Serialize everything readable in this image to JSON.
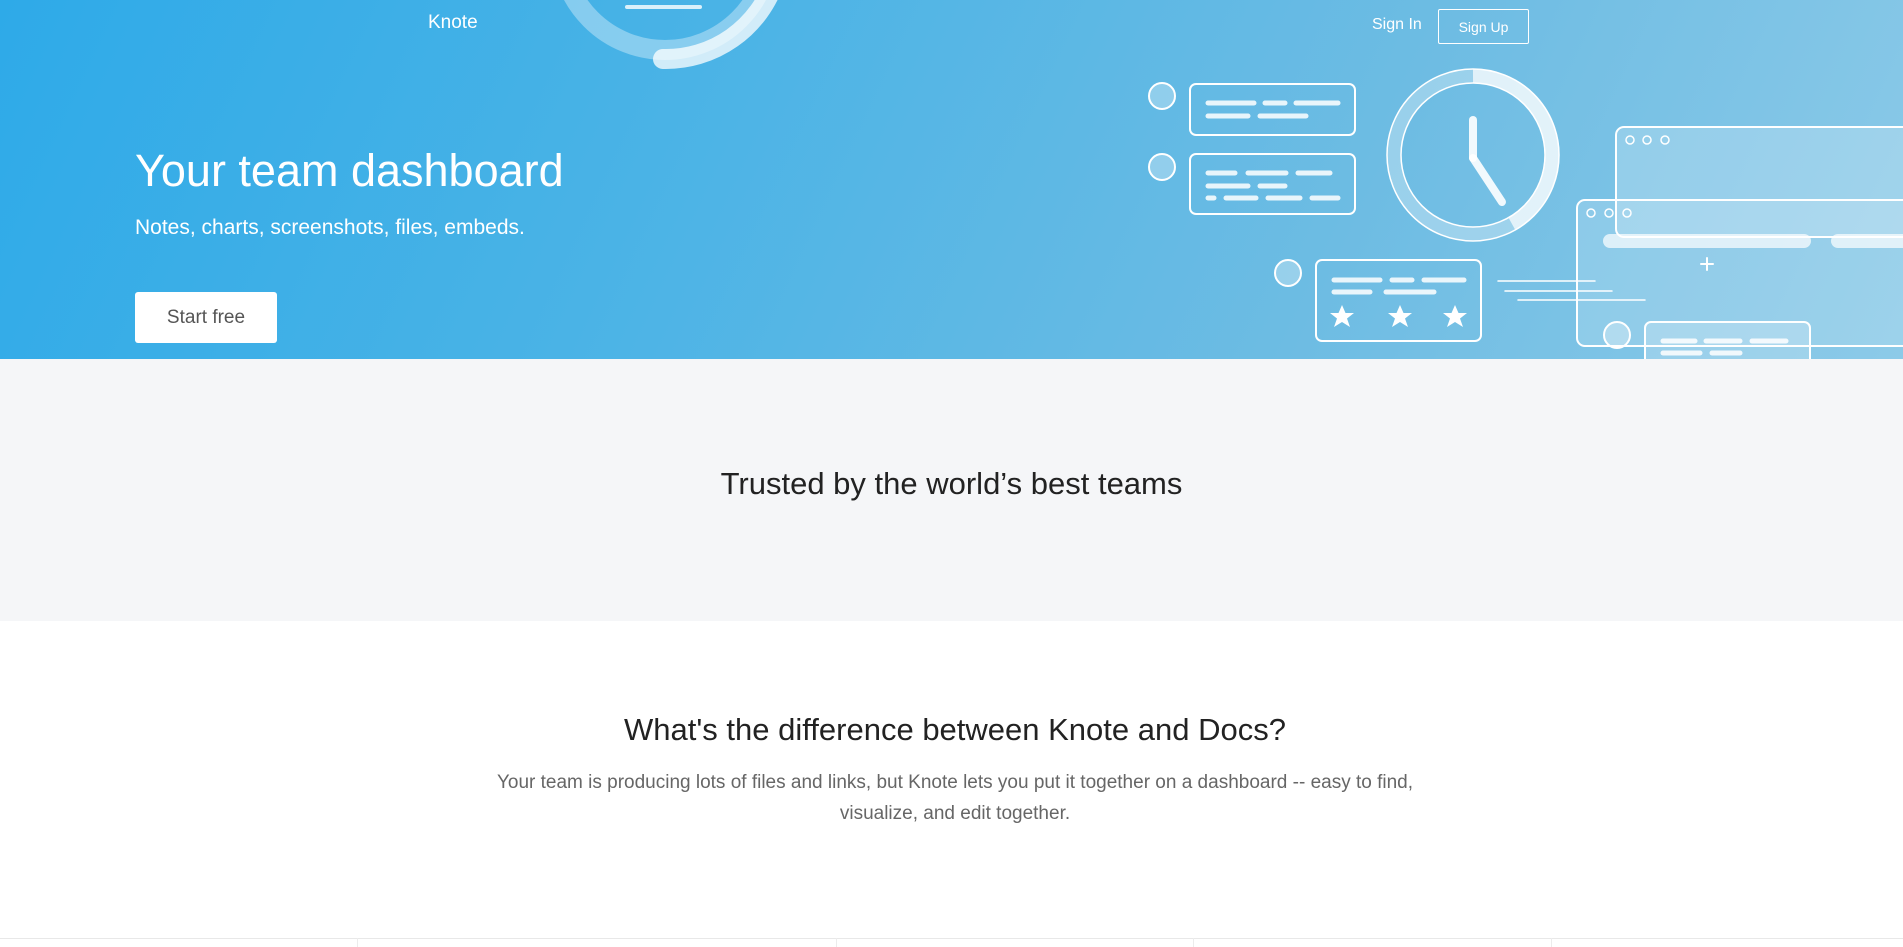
{
  "header": {
    "brand": "Knote",
    "sign_in": "Sign In",
    "sign_up": "Sign Up"
  },
  "hero": {
    "title": "Your team dashboard",
    "subtitle": "Notes, charts, screenshots, files, embeds.",
    "cta": "Start free"
  },
  "trusted": {
    "title": "Trusted by the world’s best teams"
  },
  "difference": {
    "title": "What's the difference between Knote and Docs?",
    "text": "Your team is producing lots of files and links, but Knote lets you put it together on a dashboard -- easy to find, visualize, and edit together."
  },
  "colors": {
    "hero_gradient_start": "#2eaae8",
    "hero_gradient_end": "#8ccae8",
    "trusted_background": "#f5f6f8"
  }
}
